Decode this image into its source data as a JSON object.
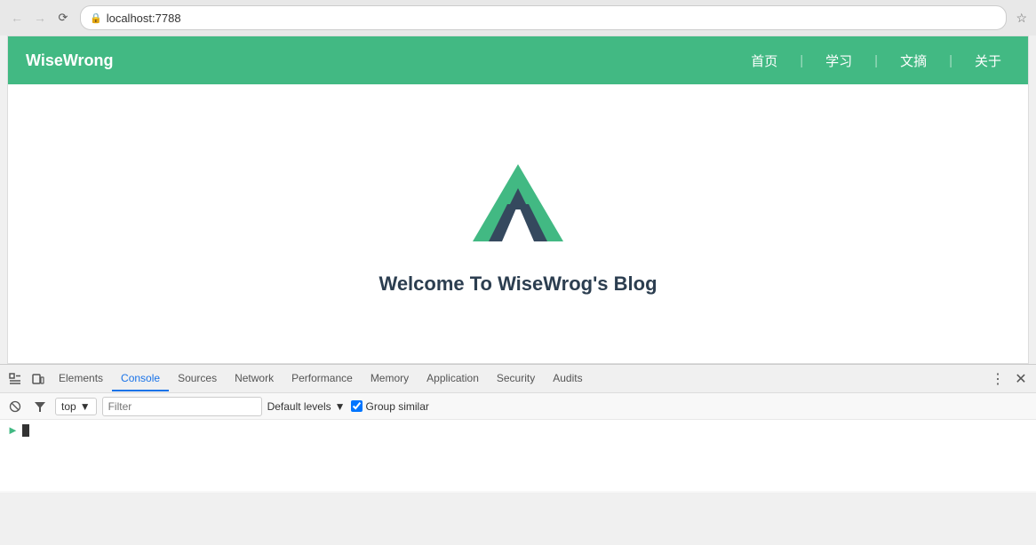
{
  "browser": {
    "back_disabled": true,
    "forward_disabled": true,
    "url": "localhost:7788",
    "star_icon": "☆"
  },
  "site": {
    "logo": "WiseWrong",
    "nav_links": [
      "首页",
      "学习",
      "文摘",
      "关于"
    ],
    "title": "Welcome To WiseWrog's Blog"
  },
  "devtools": {
    "tabs": [
      {
        "label": "Elements",
        "active": false
      },
      {
        "label": "Console",
        "active": true
      },
      {
        "label": "Sources",
        "active": false
      },
      {
        "label": "Network",
        "active": false
      },
      {
        "label": "Performance",
        "active": false
      },
      {
        "label": "Memory",
        "active": false
      },
      {
        "label": "Application",
        "active": false
      },
      {
        "label": "Security",
        "active": false
      },
      {
        "label": "Audits",
        "active": false
      }
    ],
    "console_bar": {
      "context": "top",
      "filter_placeholder": "Filter",
      "levels_label": "Default levels",
      "group_similar_label": "Group similar",
      "group_similar_checked": true
    }
  }
}
